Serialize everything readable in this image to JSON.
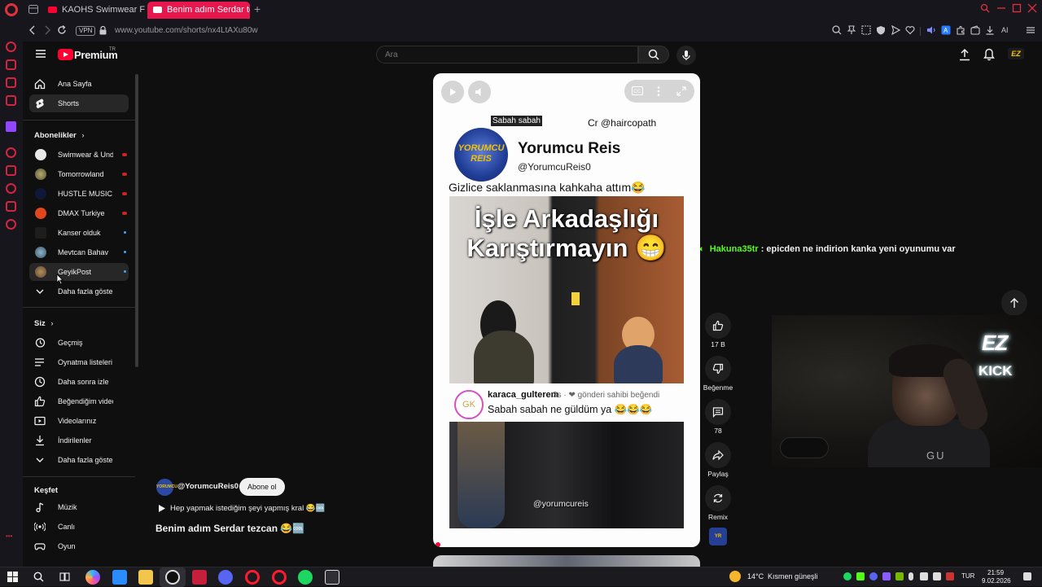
{
  "browser": {
    "tabs": [
      {
        "label": "KAOHS Swimwear Fashion",
        "active": false
      },
      {
        "label": "Benim adım Serdar tezcan",
        "active": true
      }
    ],
    "vpn_label": "VPN",
    "url": "www.youtube.com/shorts/nx4LtAXu80w",
    "ai_label": "AI"
  },
  "masthead": {
    "brand": "Premium",
    "country": "TR",
    "search_placeholder": "Ara",
    "channel_badge": "EZ"
  },
  "guide": {
    "home": "Ana Sayfa",
    "shorts": "Shorts",
    "subscriptions_header": "Abonelikler",
    "subscriptions": [
      {
        "name": "Swimwear & Und...",
        "status": "live"
      },
      {
        "name": "Tomorrowland",
        "status": "live"
      },
      {
        "name": "HUSTLE MUSIC (...",
        "status": "live"
      },
      {
        "name": "DMAX Turkiye",
        "status": "live"
      },
      {
        "name": "Kanser olduk",
        "status": "new"
      },
      {
        "name": "Mevtcan Bahav",
        "status": "new"
      },
      {
        "name": "GeyikPost",
        "status": "new"
      }
    ],
    "show_more_subs": "Daha fazla göster",
    "you_header": "Siz",
    "you_items": [
      {
        "label": "Geçmiş",
        "icon": "history-icon"
      },
      {
        "label": "Oynatma listeleri",
        "icon": "playlists-icon"
      },
      {
        "label": "Daha sonra izle",
        "icon": "watch-later-icon"
      },
      {
        "label": "Beğendiğim videolar",
        "icon": "liked-icon"
      },
      {
        "label": "Videolarınız",
        "icon": "your-videos-icon"
      },
      {
        "label": "İndirilenler",
        "icon": "downloads-icon"
      }
    ],
    "show_more_you": "Daha fazla göster",
    "explore_header": "Keşfet",
    "explore_items": [
      {
        "label": "Müzik",
        "icon": "music-icon"
      },
      {
        "label": "Canlı",
        "icon": "live-icon"
      },
      {
        "label": "Oyun",
        "icon": "gaming-icon"
      }
    ]
  },
  "short": {
    "caption_tag": "Sabah sabah",
    "credit": "Cr @haircopath",
    "logo_text": "YORUMCU REIS",
    "channel_name": "Yorumcu Reis",
    "channel_handle": "@YorumcuReis0",
    "top_caption": "Gizlice saklanmasına kahkaha attım😂",
    "overlay_title": "İşle Arkadaşlığı Karıştırmayın 😁",
    "comment_avatar": "GK",
    "comment_user": "karaca_gulterem",
    "comment_meta": "3s · ❤ gönderi sahibi beğendi",
    "comment_text": "Sabah sabah ne güldüm ya 😂😂😂",
    "watermark": "@yorumcureis"
  },
  "actions": {
    "like_count": "17 B",
    "dislike_label": "Beğenme",
    "comments_count": "78",
    "share_label": "Paylaş",
    "remix_label": "Remix"
  },
  "meta": {
    "avatar_text": "YORUMCU",
    "channel": "@YorumcuReis0",
    "subscribe": "Abone ol",
    "description": "Hep yapmak istediğim şeyi yapmış kral 😂🆒",
    "title": "Benim adım Serdar tezcan 😂🆒"
  },
  "stream": {
    "chat_user": "Hakuna35tr",
    "chat_message": ": epicden ne indirion kanka yeni oyunumu var",
    "neon_top": "EZ",
    "neon_bottom": "KICK",
    "shirt_text": "GU"
  },
  "taskbar": {
    "temperature": "14°C",
    "weather": "Kısmen güneşli",
    "language": "TUR",
    "time": "21:59",
    "date": "9.02.2026"
  },
  "colors": {
    "youtube_red": "#ff0033",
    "opera_red": "#e0313d",
    "active_tab": "#e7174d",
    "chat_green": "#53fc18"
  }
}
